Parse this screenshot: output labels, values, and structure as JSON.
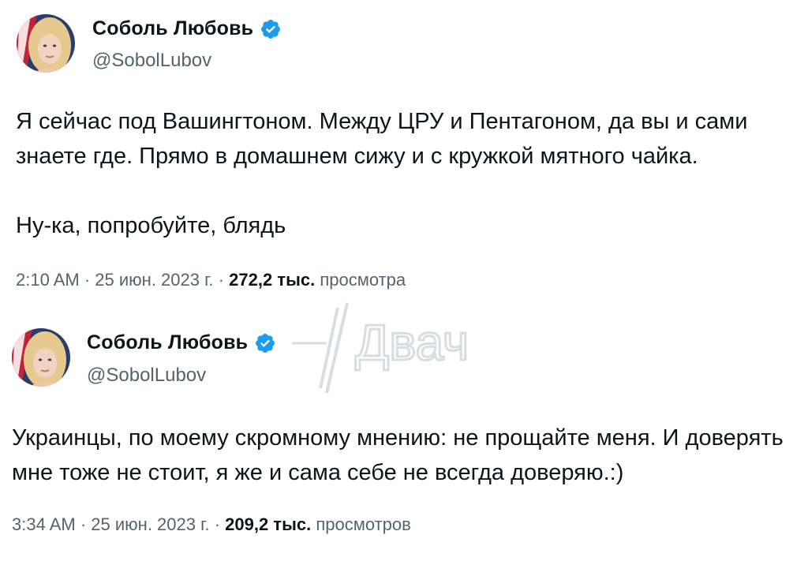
{
  "colors": {
    "verified": "#1d9bf0",
    "text_primary": "#0f1419",
    "text_secondary": "#536471",
    "background": "#ffffff",
    "watermark": "#d9dde0"
  },
  "tweets": [
    {
      "author": {
        "name": "Соболь Любовь",
        "handle": "@SobolLubov",
        "badge_icon": "verified-badge-icon",
        "avatar_icon": "avatar-photo"
      },
      "text": "Я сейчас под Вашингтоном. Между ЦРУ и Пентагоном, да вы и сами знаете где. Прямо в домашнем сижу и с кружкой мятного чайка.\n\nНу-ка, попробуйте, блядь",
      "time": "2:10 AM",
      "date": "25 июн. 2023 г.",
      "views_count": "272,2 тыс.",
      "views_label": "просмотра",
      "separator": "·"
    },
    {
      "author": {
        "name": "Соболь Любовь",
        "handle": "@SobolLubov",
        "badge_icon": "verified-badge-icon",
        "avatar_icon": "avatar-photo"
      },
      "text": "Украинцы, по моему скромному мнению: не прощайте меня. И доверять мне тоже не стоит, я же и сама себе не всегда доверяю.:)",
      "time": "3:34 AM",
      "date": "25 июн. 2023 г.",
      "views_count": "209,2 тыс.",
      "views_label": "просмотров",
      "separator": "·"
    }
  ],
  "watermark": {
    "text": "Двач"
  }
}
